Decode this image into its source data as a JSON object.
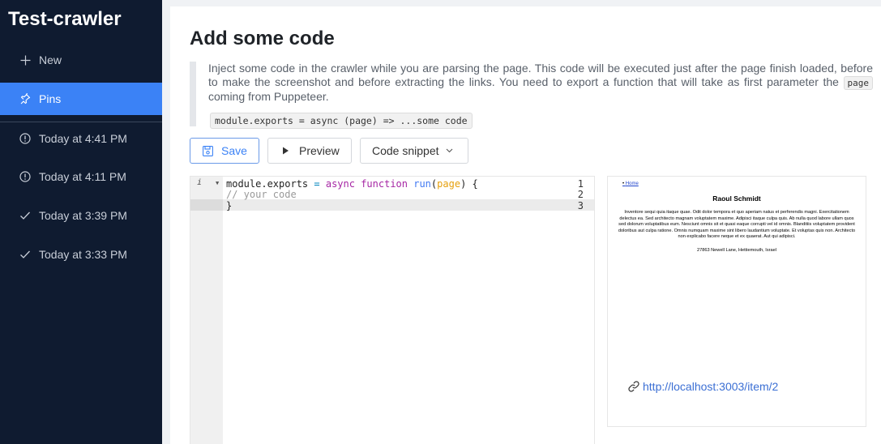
{
  "app": {
    "title": "Test-crawler"
  },
  "sidebar": {
    "new_label": "New",
    "pins_label": "Pins",
    "history": [
      {
        "label": "Today at 4:41 PM",
        "status": "warning"
      },
      {
        "label": "Today at 4:11 PM",
        "status": "warning"
      },
      {
        "label": "Today at 3:39 PM",
        "status": "success"
      },
      {
        "label": "Today at 3:33 PM",
        "status": "success"
      }
    ]
  },
  "main": {
    "title": "Add some code",
    "description_part1": "Inject some code in the crawler while you are parsing the page. This code will be executed just after the page finish loaded, before to make the screenshot and before extracting the links. You need to export a function that will take as first parameter the",
    "description_code": "page",
    "description_part2": "coming from Puppeteer.",
    "code_example": "module.exports = async (page) => ...some code"
  },
  "toolbar": {
    "save_label": "Save",
    "preview_label": "Preview",
    "snippet_label": "Code snippet"
  },
  "editor": {
    "line_numbers": [
      "1",
      "2",
      "3"
    ],
    "line1": {
      "a": "module.exports ",
      "eq": "=",
      "b": " ",
      "kw1": "async",
      "c": " ",
      "kw2": "function",
      "d": " ",
      "fn": "run",
      "e": "(",
      "param": "page",
      "f": ") {"
    },
    "line2": "// your code",
    "line3": "}"
  },
  "preview": {
    "link": "Home",
    "title": "Raoul Schmidt",
    "text": "Inventore sequi quia itaque quae. Odit dolor tempora et quo aperiam natus et perferendis magni. Exercitationem delectus ea. Sed architecto magnam voluptatem maxime. Adipisci itaque culpa quis. Ab nulla quod labore ullam quos sed dolorum voluptatibus eum. Nesciunt omnis sit et quasi eaque corrupti vel id omnis. Blanditiis voluptatem provident doloribus aut culpa ratione. Omnis numquam maxime sint libero laudantium voluptate. Et voluptas quis non. Architecto non explicabo facere neque et ex quaerat. Aut qui adipisci.",
    "address": "27863 Newell Lane, Hettiemouth, Israel",
    "url": "http://localhost:3003/item/2"
  },
  "colors": {
    "sidebar_bg": "#0f1b30",
    "accent": "#3b82f6"
  }
}
